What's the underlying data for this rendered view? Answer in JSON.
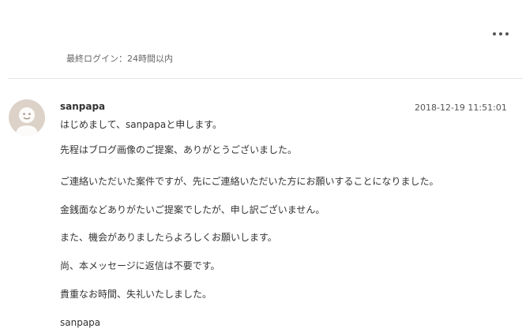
{
  "header": {
    "more_icon": "more-horizontal-icon",
    "last_login": "最終ログイン：24時間以内"
  },
  "message": {
    "avatar_icon": "user-avatar-icon",
    "sender": "sanpapa",
    "timestamp": "2018-12-19 11:51:01",
    "lines": [
      "はじめまして、sanpapaと申します。",
      "先程はブログ画像のご提案、ありがとうございました。",
      "ご連絡いただいた案件ですが、先にご連絡いただいた方にお願いすることになりました。",
      "金銭面などありがたいご提案でしたが、申し訳ございません。",
      "また、機会がありましたらよろしくお願いします。",
      "尚、本メッセージに返信は不要です。",
      "貴重なお時間、失礼いたしました。",
      "sanpapa"
    ]
  },
  "colors": {
    "text": "#333333",
    "muted": "#666666",
    "divider": "#c8c8c8",
    "avatar_bg": "#dcd2c8"
  }
}
